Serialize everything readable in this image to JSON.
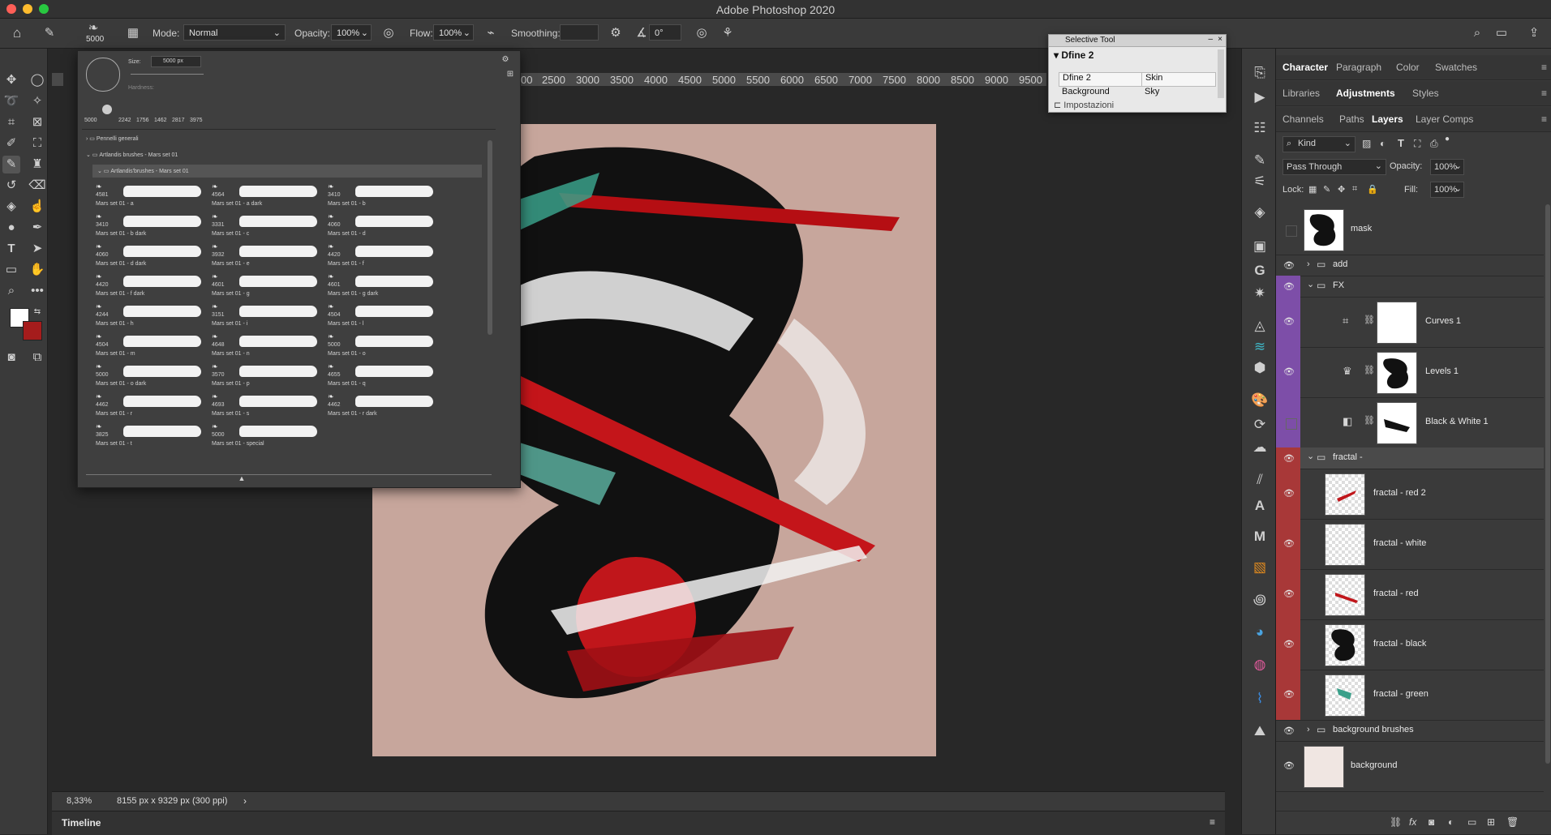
{
  "window": {
    "title": "Adobe Photoshop 2020"
  },
  "options": {
    "brush_size": "5000",
    "mode_label": "Mode:",
    "mode_value": "Normal",
    "opacity_label": "Opacity:",
    "opacity_value": "100%",
    "flow_label": "Flow:",
    "flow_value": "100%",
    "smoothing_label": "Smoothing:",
    "smoothing_value": "",
    "angle_value": "0°"
  },
  "ruler": {
    "ticks": [
      "00",
      "2500",
      "3000",
      "3500",
      "4000",
      "4500",
      "5000",
      "5500",
      "6000",
      "6500",
      "7000",
      "7500",
      "8000",
      "8500",
      "9000",
      "9500"
    ]
  },
  "brush_popup": {
    "size_label": "Size:",
    "size_value": "5000 px",
    "hardness_label": "Hardness:",
    "presets": [
      "5000",
      "2242",
      "1756",
      "1462",
      "2817",
      "3975"
    ],
    "folders": [
      "Pennelli generali",
      "Artlandis brushes - Mars set 01",
      "Artlandis'brushes - Mars set 01"
    ],
    "brushes": [
      {
        "size": "4581",
        "name": "Mars set 01 - a"
      },
      {
        "size": "4564",
        "name": "Mars set 01 - a dark"
      },
      {
        "size": "3410",
        "name": "Mars set 01 - b"
      },
      {
        "size": "3410",
        "name": "Mars set 01 - b dark"
      },
      {
        "size": "3331",
        "name": "Mars set 01 - c"
      },
      {
        "size": "4060",
        "name": "Mars set 01 - d"
      },
      {
        "size": "4060",
        "name": "Mars set 01 - d dark"
      },
      {
        "size": "3932",
        "name": "Mars set 01 - e"
      },
      {
        "size": "4420",
        "name": "Mars set 01 - f"
      },
      {
        "size": "4420",
        "name": "Mars set 01 - f dark"
      },
      {
        "size": "4601",
        "name": "Mars set 01 - g"
      },
      {
        "size": "4601",
        "name": "Mars set 01 - g dark"
      },
      {
        "size": "4244",
        "name": "Mars set 01 - h"
      },
      {
        "size": "3151",
        "name": "Mars set 01 - i"
      },
      {
        "size": "4504",
        "name": "Mars set 01 - l"
      },
      {
        "size": "4504",
        "name": "Mars set 01 - m"
      },
      {
        "size": "4648",
        "name": "Mars set 01 - n"
      },
      {
        "size": "5000",
        "name": "Mars set 01 - o"
      },
      {
        "size": "5000",
        "name": "Mars set 01 - o dark"
      },
      {
        "size": "3570",
        "name": "Mars set 01 - p"
      },
      {
        "size": "4655",
        "name": "Mars set 01 - q"
      },
      {
        "size": "4462",
        "name": "Mars set 01 - r"
      },
      {
        "size": "4693",
        "name": "Mars set 01 - s"
      },
      {
        "size": "4462",
        "name": "Mars set 01 - r dark"
      },
      {
        "size": "3825",
        "name": "Mars set 01 - t"
      },
      {
        "size": "5000",
        "name": "Mars set 01 - special"
      }
    ]
  },
  "selective_tool": {
    "title": "Selective Tool",
    "header": "Dfine 2",
    "row1_left": "Dfine 2",
    "row1_right": "Skin",
    "row2_left": "Background",
    "row2_right": "Sky",
    "footer": "Impostazioni"
  },
  "status": {
    "zoom": "8,33%",
    "doc_info": "8155 px x 9329 px (300 ppi)"
  },
  "timeline": {
    "label": "Timeline"
  },
  "panels": {
    "row1": [
      "Character",
      "Paragraph",
      "Color",
      "Swatches"
    ],
    "row2": [
      "Libraries",
      "Adjustments",
      "Styles"
    ],
    "row3": [
      "Channels",
      "Paths",
      "Layers",
      "Layer Comps"
    ]
  },
  "layers_controls": {
    "kind": "Kind",
    "blend_mode": "Pass Through",
    "opacity_label": "Opacity:",
    "opacity_value": "100%",
    "lock_label": "Lock:",
    "fill_label": "Fill:",
    "fill_value": "100%"
  },
  "layers": [
    {
      "name": "mask"
    },
    {
      "name": "add"
    },
    {
      "name": "FX"
    },
    {
      "name": "Curves 1"
    },
    {
      "name": "Levels 1"
    },
    {
      "name": "Black & White 1"
    },
    {
      "name": "fractal -"
    },
    {
      "name": "fractal - red 2"
    },
    {
      "name": "fractal - white"
    },
    {
      "name": "fractal - red"
    },
    {
      "name": "fractal - black"
    },
    {
      "name": "fractal - green"
    },
    {
      "name": "background brushes"
    },
    {
      "name": "background"
    }
  ],
  "colors": {
    "purple_label": "#7d4ea8",
    "red_label": "#a83838",
    "foreground": "#ffffff",
    "background": "#a51c1c",
    "artwork_bg": "#c7a69c"
  }
}
